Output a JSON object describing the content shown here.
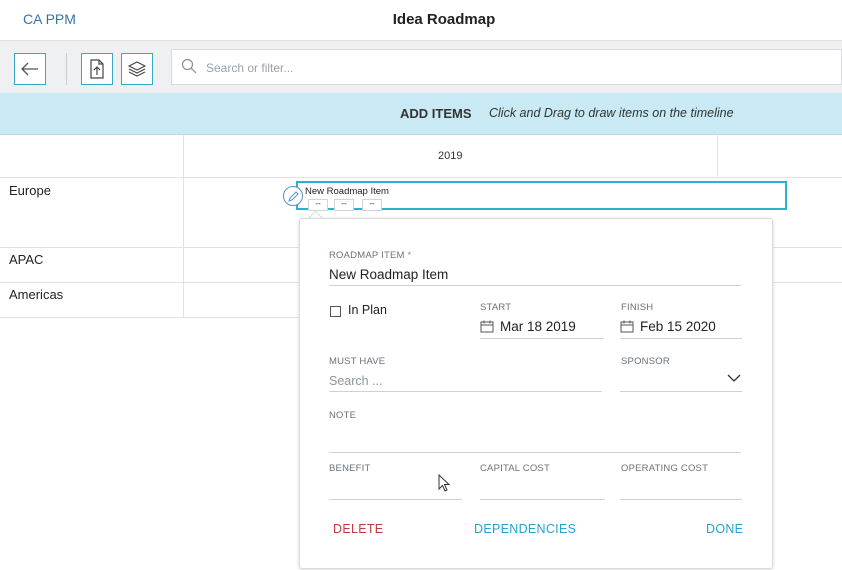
{
  "app": {
    "brand": "CA PPM",
    "title": "Idea Roadmap"
  },
  "toolbar": {
    "back_icon": "arrow-left-icon",
    "export_icon": "export-upload-icon",
    "layers_icon": "layers-icon",
    "search_placeholder": "Search or filter..."
  },
  "banner": {
    "title": "ADD ITEMS",
    "hint": "Click and Drag to draw items on the timeline"
  },
  "timeline": {
    "year": "2019",
    "rows": [
      "Europe",
      "APAC",
      "Americas"
    ]
  },
  "item_bar": {
    "label": "New Roadmap Item",
    "mini": [
      "--",
      "--",
      "--"
    ]
  },
  "popover": {
    "roadmap_item_label": "ROADMAP ITEM",
    "required_mark": "*",
    "roadmap_item_value": "New Roadmap Item",
    "in_plan_label": "In Plan",
    "start_label": "START",
    "start_value": "Mar 18 2019",
    "finish_label": "FINISH",
    "finish_value": "Feb 15 2020",
    "must_have_label": "MUST HAVE",
    "must_have_placeholder": "Search ...",
    "sponsor_label": "SPONSOR",
    "note_label": "NOTE",
    "benefit_label": "BENEFIT",
    "capital_cost_label": "CAPITAL COST",
    "operating_cost_label": "OPERATING COST",
    "delete_label": "DELETE",
    "dependencies_label": "DEPENDENCIES",
    "done_label": "DONE"
  },
  "colors": {
    "accent": "#27a3c9",
    "brand": "#3a72a8",
    "danger": "#c0393f",
    "banner": "#c9eaf4"
  }
}
